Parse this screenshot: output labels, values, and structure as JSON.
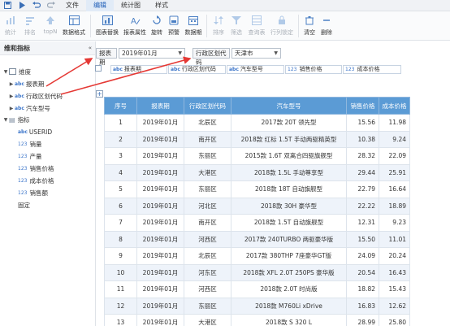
{
  "titlebar": {
    "menus": [
      "文件",
      "编辑",
      "统计图",
      "样式"
    ]
  },
  "ribbon": {
    "buttons": [
      {
        "label": "统计",
        "icon": "statistics-icon",
        "disabled": true
      },
      {
        "label": "排名",
        "icon": "rank-icon",
        "disabled": true
      },
      {
        "label": "topN",
        "icon": "topn-icon",
        "disabled": true
      },
      {
        "label": "数据格式",
        "icon": "data-format-icon",
        "disabled": false
      },
      {
        "label": "图表替换",
        "icon": "chart-replace-icon",
        "disabled": false
      },
      {
        "label": "报表属性",
        "icon": "report-props-icon",
        "disabled": false
      },
      {
        "label": "旋转",
        "icon": "rotate-icon",
        "disabled": false
      },
      {
        "label": "预警",
        "icon": "alert-icon",
        "disabled": false
      },
      {
        "label": "数据期",
        "icon": "data-period-icon",
        "disabled": false
      },
      {
        "label": "排序",
        "icon": "sort-icon",
        "disabled": true
      },
      {
        "label": "筛选",
        "icon": "filter-icon",
        "disabled": true
      },
      {
        "label": "查询表",
        "icon": "query-table-icon",
        "disabled": true
      },
      {
        "label": "行列锁定",
        "icon": "lock-icon",
        "disabled": true
      },
      {
        "label": "清空",
        "icon": "clear-icon",
        "disabled": false
      },
      {
        "label": "删除",
        "icon": "delete-icon",
        "disabled": false
      }
    ]
  },
  "leftpanel": {
    "title": "维和指标",
    "dimension_group": "维度",
    "dimensions": [
      "报表期",
      "行政区划代码",
      "汽车型号"
    ],
    "measure_group": "指标",
    "measures": [
      {
        "tag": "abc",
        "label": "USERID"
      },
      {
        "tag": "123",
        "label": "销量"
      },
      {
        "tag": "123",
        "label": "产量"
      },
      {
        "tag": "123",
        "label": "销售价格"
      },
      {
        "tag": "123",
        "label": "成本价格"
      },
      {
        "tag": "123",
        "label": "销售额"
      }
    ],
    "fixed": "固定"
  },
  "filters": {
    "period_label": "报表期",
    "period_value": "2019年01月",
    "region_label": "行政区划代码",
    "region_value": "天津市"
  },
  "fields": {
    "tags": [
      "abc",
      "abc",
      "abc",
      "123",
      "123"
    ],
    "labels": [
      "报表期",
      "行政区划代码",
      "汽车型号",
      "销售价格",
      "成本价格"
    ]
  },
  "table": {
    "headers": [
      "序号",
      "报表期",
      "行政区划代码",
      "汽车型号",
      "销售价格",
      "成本价格"
    ],
    "rows": [
      [
        "1",
        "2019年01月",
        "北辰区",
        "2017款 20T 领先型",
        "15.56",
        "11.98"
      ],
      [
        "2",
        "2019年01月",
        "南开区",
        "2018款 红标 1.5T 手动两驱精英型",
        "10.38",
        "9.24"
      ],
      [
        "3",
        "2019年01月",
        "东丽区",
        "2015款 1.6T 双离合四驱旗舰型",
        "28.32",
        "22.09"
      ],
      [
        "4",
        "2019年01月",
        "大港区",
        "2018款 1.5L 手动尊享型",
        "29.44",
        "25.91"
      ],
      [
        "5",
        "2019年01月",
        "东丽区",
        "2018款 18T 自动旗舰型",
        "22.79",
        "16.64"
      ],
      [
        "6",
        "2019年01月",
        "河北区",
        "2018款 30H 豪华型",
        "22.22",
        "18.89"
      ],
      [
        "7",
        "2019年01月",
        "南开区",
        "2018款 1.5T 自动旗舰型",
        "12.31",
        "9.23"
      ],
      [
        "8",
        "2019年01月",
        "河西区",
        "2017款 240TURBO 两驱豪华版",
        "15.50",
        "11.01"
      ],
      [
        "9",
        "2019年01月",
        "北辰区",
        "2017款 380THP 7座豪华GT版",
        "24.09",
        "20.24"
      ],
      [
        "10",
        "2019年01月",
        "河东区",
        "2018款 XFL 2.0T 250PS 豪华版",
        "20.54",
        "16.43"
      ],
      [
        "11",
        "2019年01月",
        "河西区",
        "2018款 2.0T 时尚版",
        "18.82",
        "15.43"
      ],
      [
        "12",
        "2019年01月",
        "东丽区",
        "2018款 M760Li xDrive",
        "16.83",
        "12.62"
      ],
      [
        "13",
        "2019年01月",
        "大港区",
        "2018款 S 320 L",
        "28.99",
        "25.80"
      ]
    ]
  },
  "colors": {
    "header_bg": "#5b9bd5",
    "alt_row_bg": "#eef3fa",
    "annotation_arrow": "#e53935"
  }
}
